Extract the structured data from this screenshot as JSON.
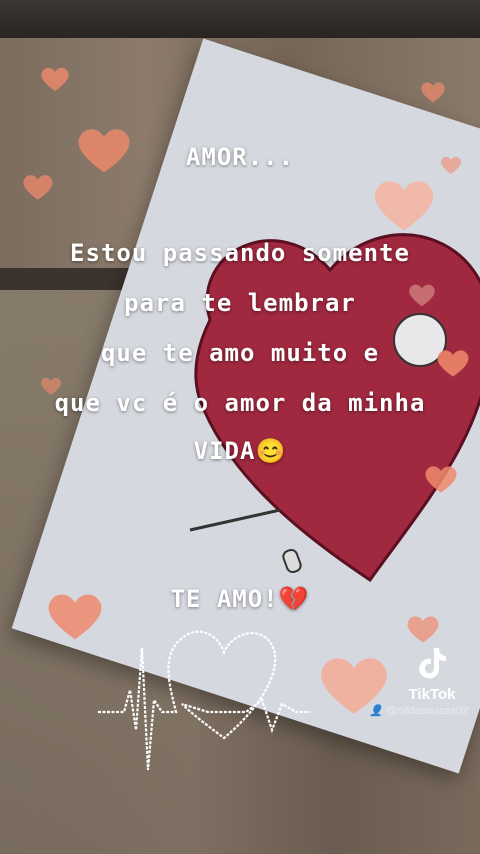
{
  "overlay": {
    "line1": "AMOR...",
    "line2": "Estou passando somente",
    "line3": "para te lembrar",
    "line4": "que te amo muito e",
    "line5": "que vc é o amor da minha",
    "line6_text": "VIDA",
    "line6_emoji": "😊",
    "line7_text": "TE AMO!",
    "line7_emoji": "💔"
  },
  "watermark": {
    "brand": "TikTok",
    "handle": "@nildasouzaa02",
    "icon": "tiktok-note-icon"
  },
  "colors": {
    "heart_red": "#a0283f",
    "floating_heart": "#f08a6c",
    "card": "#d6d8e0"
  }
}
